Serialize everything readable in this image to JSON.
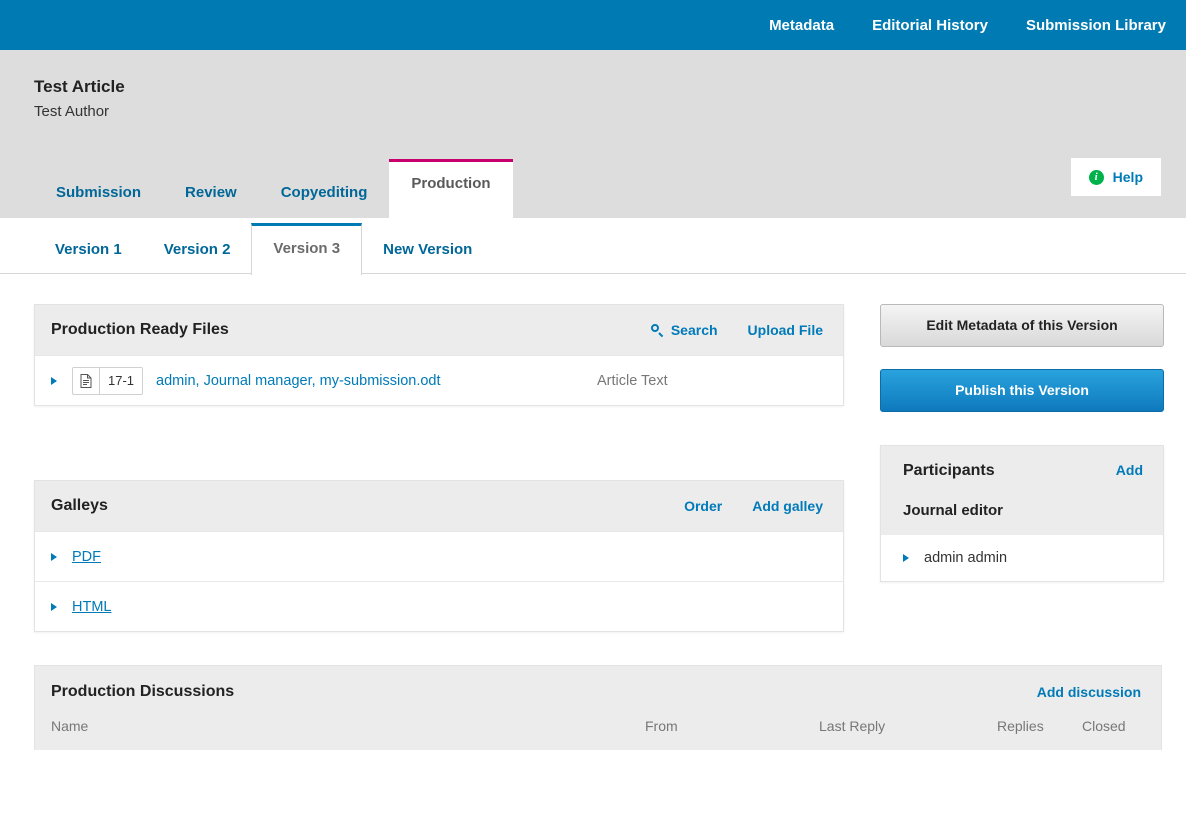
{
  "topnav": {
    "items": [
      {
        "label": "Metadata",
        "name": "metadata"
      },
      {
        "label": "Editorial History",
        "name": "editorial-history"
      },
      {
        "label": "Submission Library",
        "name": "submission-library"
      }
    ]
  },
  "submission": {
    "title": "Test Article",
    "author": "Test Author"
  },
  "workflow_tabs": [
    {
      "label": "Submission",
      "active": false
    },
    {
      "label": "Review",
      "active": false
    },
    {
      "label": "Copyediting",
      "active": false
    },
    {
      "label": "Production",
      "active": true
    }
  ],
  "help": {
    "label": "Help",
    "icon": "info-icon"
  },
  "version_tabs": [
    {
      "label": "Version 1",
      "active": false
    },
    {
      "label": "Version 2",
      "active": false
    },
    {
      "label": "Version 3",
      "active": true
    },
    {
      "label": "New Version",
      "active": false
    }
  ],
  "production_ready_files": {
    "title": "Production Ready Files",
    "search_label": "Search",
    "upload_label": "Upload File",
    "files": [
      {
        "id": "17-1",
        "name": "admin, Journal manager, my-submission.odt",
        "type": "Article Text"
      }
    ]
  },
  "galleys": {
    "title": "Galleys",
    "order_label": "Order",
    "add_label": "Add galley",
    "items": [
      {
        "label": "PDF"
      },
      {
        "label": "HTML"
      }
    ]
  },
  "sidebar": {
    "edit_metadata_label": "Edit Metadata of this Version",
    "publish_label": "Publish this Version",
    "participants": {
      "title": "Participants",
      "add_label": "Add",
      "role": "Journal editor",
      "people": [
        {
          "name": "admin admin"
        }
      ]
    }
  },
  "discussions": {
    "title": "Production Discussions",
    "add_label": "Add discussion",
    "columns": {
      "name": "Name",
      "from": "From",
      "last_reply": "Last Reply",
      "replies": "Replies",
      "closed": "Closed"
    },
    "rows": []
  },
  "colors": {
    "topbar": "#007ab2",
    "accent_link": "#007ab8",
    "active_tab_border": "#c8006e",
    "version_tab_border": "#007ab2",
    "header_bg": "#dddddd",
    "panel_head_bg": "#ececec",
    "info_green": "#00b24a"
  }
}
